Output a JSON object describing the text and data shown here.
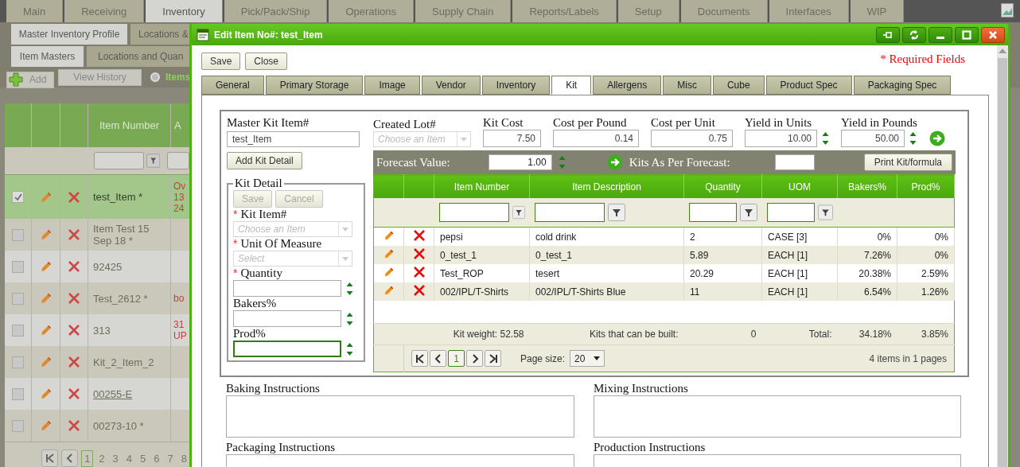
{
  "nav_tabs": [
    {
      "label": "Main",
      "selected": false
    },
    {
      "label": "Receiving",
      "selected": false
    },
    {
      "label": "Inventory",
      "selected": true
    },
    {
      "label": "Pick/Pack/Ship",
      "selected": false
    },
    {
      "label": "Operations",
      "selected": false
    },
    {
      "label": "Supply Chain",
      "selected": false
    },
    {
      "label": "Reports/Labels",
      "selected": false
    },
    {
      "label": "Setup",
      "selected": false
    },
    {
      "label": "Documents",
      "selected": false
    },
    {
      "label": "Interfaces",
      "selected": false
    },
    {
      "label": "WIP",
      "selected": false
    }
  ],
  "subnav_tabs": [
    {
      "label": "Master Inventory Profile",
      "selected": true
    },
    {
      "label": "Locations &",
      "selected": false
    }
  ],
  "page_tabs": [
    {
      "label": "Item Masters",
      "selected": true
    },
    {
      "label": "Locations and Quan",
      "selected": false
    }
  ],
  "toolbar": {
    "add": "Add",
    "view_history": "View History",
    "filter_label": "Items"
  },
  "items_grid": {
    "columns": [
      "Item Number",
      "A"
    ],
    "rows": [
      {
        "item": "test_Item *",
        "note": [
          "Ov",
          "13",
          "24"
        ],
        "checked": true,
        "selected": true,
        "link": false
      },
      {
        "item": "Item Test 15 Sep 18 *",
        "note": [],
        "checked": false,
        "selected": false,
        "link": false
      },
      {
        "item": "92425",
        "note": [],
        "checked": false,
        "selected": false,
        "link": false
      },
      {
        "item": "Test_2612 *",
        "note": [
          "bo"
        ],
        "checked": false,
        "selected": false,
        "link": false
      },
      {
        "item": "313",
        "note": [
          "31",
          "UP"
        ],
        "checked": false,
        "selected": false,
        "link": false
      },
      {
        "item": "Kit_2_Item_2",
        "note": [],
        "checked": false,
        "selected": false,
        "link": false
      },
      {
        "item": "00255-E",
        "note": [],
        "checked": false,
        "selected": false,
        "link": true
      },
      {
        "item": "00273-10 *",
        "note": [],
        "checked": false,
        "selected": false,
        "link": false
      }
    ],
    "pages": [
      {
        "label": "1",
        "selected": true
      },
      {
        "label": "2",
        "selected": false
      },
      {
        "label": "3",
        "selected": false
      },
      {
        "label": "4",
        "selected": false
      },
      {
        "label": "5",
        "selected": false
      },
      {
        "label": "6",
        "selected": false
      },
      {
        "label": "7",
        "selected": false
      },
      {
        "label": "8",
        "selected": false
      }
    ]
  },
  "dialog": {
    "title": "Edit Item No#: test_Item",
    "buttons": [
      "Save",
      "Close"
    ],
    "required_note": "* Required Fields",
    "tabs": [
      {
        "label": "General",
        "selected": false
      },
      {
        "label": "Primary Storage",
        "selected": false
      },
      {
        "label": "Image",
        "selected": false
      },
      {
        "label": "Vendor",
        "selected": false
      },
      {
        "label": "Inventory",
        "selected": false
      },
      {
        "label": "Kit",
        "selected": true
      },
      {
        "label": "Allergens",
        "selected": false
      },
      {
        "label": "Misc",
        "selected": false
      },
      {
        "label": "Cube",
        "selected": false
      },
      {
        "label": "Product Spec",
        "selected": false
      },
      {
        "label": "Packaging Spec",
        "selected": false
      }
    ],
    "kit": {
      "master_label": "Master Kit Item#",
      "master_value": "test_Item",
      "add_detail": "Add Kit Detail",
      "detail": {
        "legend": "Kit Detail",
        "buttons": [
          {
            "label": "Save",
            "disabled": true
          },
          {
            "label": "Cancel",
            "disabled": true
          }
        ],
        "fields": [
          {
            "kind": "select",
            "mark": "*",
            "label": "Kit Item#",
            "placeholder": "Choose an Item"
          },
          {
            "kind": "select",
            "mark": "*",
            "label": "Unit Of Measure",
            "placeholder": "Select"
          },
          {
            "kind": "spinner",
            "mark": "*",
            "label": "Quantity",
            "focused": false
          },
          {
            "kind": "spinner",
            "label": "Bakers%",
            "focused": false
          },
          {
            "kind": "spinner",
            "label": "Prod%",
            "focused": true
          }
        ]
      },
      "header_fields": [
        {
          "kind": "select",
          "label": "Created Lot#",
          "placeholder": "Choose an Item"
        },
        {
          "kind": "number",
          "label": "Kit Cost",
          "value": "7.50"
        },
        {
          "kind": "number",
          "label": "Cost per Pound",
          "value": "0.14"
        },
        {
          "kind": "number",
          "label": "Cost per Unit",
          "value": "0.75"
        },
        {
          "kind": "spinner",
          "label": "Yield in Units",
          "value": "10.00"
        },
        {
          "kind": "spinner",
          "label": "Yield in Pounds",
          "value": "50.00"
        }
      ],
      "forecast": {
        "label": "Forecast Value:",
        "value": "1.00",
        "result_label": "Kits As Per Forecast:",
        "print_button": "Print Kit/formula"
      },
      "grid": {
        "columns": [
          {
            "label": "Item Number",
            "kind": "text",
            "filterable": true
          },
          {
            "label": "Item Description",
            "kind": "text",
            "filterable": true
          },
          {
            "label": "Quantity",
            "kind": "text",
            "filterable": true
          },
          {
            "label": "UOM",
            "kind": "text",
            "filterable": true
          },
          {
            "label": "Bakers%",
            "kind": "number",
            "filterable": false
          },
          {
            "label": "Prod%",
            "kind": "number",
            "filterable": false
          }
        ],
        "rows": [
          {
            "cells": [
              "pepsi",
              "cold drink",
              "2",
              "CASE [3]",
              "0%",
              "0%"
            ]
          },
          {
            "cells": [
              "0_test_1",
              "0_test_1",
              "5.89",
              "EACH [1]",
              "7.26%",
              "0%"
            ]
          },
          {
            "cells": [
              "Test_ROP",
              "tesert",
              "20.29",
              "EACH [1]",
              "20.38%",
              "2.59%"
            ]
          },
          {
            "cells": [
              "002/IPL/T-Shirts",
              "002/IPL/T-Shirts Blue",
              "11",
              "EACH [1]",
              "6.54%",
              "1.26%"
            ]
          }
        ],
        "footer": {
          "kit_weight": "Kit weight: 52.58",
          "buildable_label": "Kits that can be built:",
          "buildable": "0",
          "total_label": "Total:",
          "bakers_total": "34.18%",
          "prod_total": "3.85%"
        },
        "pager": {
          "pages": [
            {
              "label": "1",
              "selected": true
            }
          ],
          "page_size_label": "Page size:",
          "page_size": "20",
          "summary": "4 items in 1 pages"
        }
      }
    },
    "instructions": [
      {
        "label": "Baking Instructions"
      },
      {
        "label": "Mixing Instructions"
      },
      {
        "label": "Packaging Instructions"
      },
      {
        "label": "Production Instructions"
      }
    ]
  }
}
